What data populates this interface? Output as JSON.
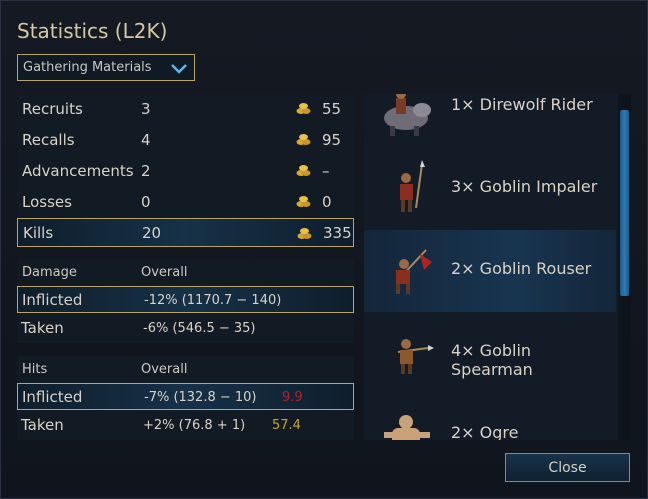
{
  "title": "Statistics (L2K)",
  "dropdown": {
    "value": "Gathering Materials"
  },
  "summary": [
    {
      "name": "Recruits",
      "value": "3",
      "gold": "55"
    },
    {
      "name": "Recalls",
      "value": "4",
      "gold": "95"
    },
    {
      "name": "Advancements",
      "value": "2",
      "gold": "–"
    },
    {
      "name": "Losses",
      "value": "0",
      "gold": "0"
    },
    {
      "name": "Kills",
      "value": "20",
      "gold": "335"
    }
  ],
  "damage": {
    "header": "Damage",
    "col": "Overall",
    "inflicted": {
      "label": "Inflicted",
      "value": "-12% (1170.7 − 140)"
    },
    "taken": {
      "label": "Taken",
      "value": "-6% (546.5 − 35)"
    }
  },
  "hits": {
    "header": "Hits",
    "col": "Overall",
    "inflicted": {
      "label": "Inflicted",
      "value": "-7% (132.8 − 10)",
      "extra": "9.9"
    },
    "taken": {
      "label": "Taken",
      "value": "+2% (76.8 + 1)",
      "extra": "57.4"
    }
  },
  "units": [
    {
      "label": "1× Direwolf Rider"
    },
    {
      "label": "3× Goblin Impaler"
    },
    {
      "label": "2× Goblin Rouser"
    },
    {
      "label": "4× Goblin Spearman"
    },
    {
      "label": "2× Ogre"
    }
  ],
  "close_label": "Close",
  "colors": {
    "accent_gold": "#b9a56a",
    "red_value": "#b0232a",
    "gold_value": "#c9a233",
    "selection": "#183550"
  }
}
